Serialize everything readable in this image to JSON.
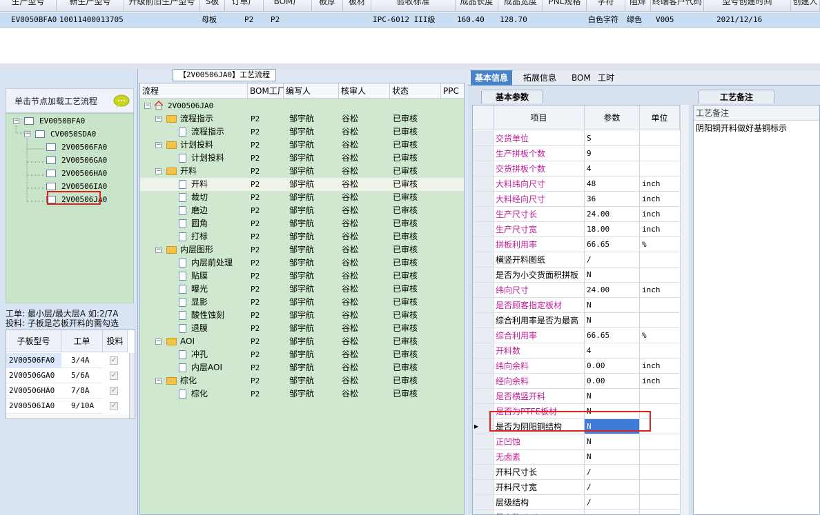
{
  "top_grid": {
    "headers": [
      "生产型号",
      "新生产型号",
      "升级前旧生产型号",
      "S板",
      "订单厂",
      "BOM厂",
      "板厚",
      "板材",
      "验收标准",
      "成品长度",
      "成品宽度",
      "PNL规格",
      "字符",
      "阻焊",
      "终端客户代码",
      "型号创建时间",
      "创建人"
    ],
    "row": [
      "EV0050BFA0",
      "10011400013705",
      "",
      "母板",
      "P2",
      "P2",
      "",
      "",
      "IPC-6012 III级",
      "160.40",
      "128.70",
      "",
      "白色字符",
      "绿色",
      "V005",
      "2021/12/16",
      ""
    ]
  },
  "left": {
    "hint": "单击节点加载工艺流程",
    "tree": [
      {
        "label": "EV0050BFA0"
      },
      {
        "label": "CV0050SDA0"
      },
      {
        "label": "2V00506FA0"
      },
      {
        "label": "2V00506GA0"
      },
      {
        "label": "2V00506HA0"
      },
      {
        "label": "2V00506IA0"
      },
      {
        "label": "2V00506JA0"
      }
    ],
    "info_line1": "工单: 最小层/最大层A 如:2/7A",
    "info_line2": "投料: 子板是芯板开料的需勾选",
    "sub_grid": {
      "headers": [
        "子板型号",
        "工单",
        "投料"
      ],
      "rows": [
        {
          "model": "2V00506FA0",
          "order": "3/4A"
        },
        {
          "model": "2V00506GA0",
          "order": "5/6A"
        },
        {
          "model": "2V00506HA0",
          "order": "7/8A"
        },
        {
          "model": "2V00506IA0",
          "order": "9/10A"
        }
      ]
    }
  },
  "middle": {
    "title": "【2V00506JA0】工艺流程",
    "headers": [
      "流程",
      "BOM工厂",
      "编写人",
      "核审人",
      "状态",
      "PPC"
    ],
    "root": "2V00506JA0",
    "rows": [
      {
        "name": "流程指示",
        "bom": "P2",
        "writer": "邹宇航",
        "reviewer": "谷松",
        "status": "已审核"
      },
      {
        "name": "流程指示",
        "bom": "P2",
        "writer": "邹宇航",
        "reviewer": "谷松",
        "status": "已审核"
      },
      {
        "name": "计划投料",
        "bom": "P2",
        "writer": "邹宇航",
        "reviewer": "谷松",
        "status": "已审核"
      },
      {
        "name": "计划投料",
        "bom": "P2",
        "writer": "邹宇航",
        "reviewer": "谷松",
        "status": "已审核"
      },
      {
        "name": "开料",
        "bom": "P2",
        "writer": "邹宇航",
        "reviewer": "谷松",
        "status": "已审核"
      },
      {
        "name": "开料",
        "bom": "P2",
        "writer": "邹宇航",
        "reviewer": "谷松",
        "status": "已审核"
      },
      {
        "name": "裁切",
        "bom": "P2",
        "writer": "邹宇航",
        "reviewer": "谷松",
        "status": "已审核"
      },
      {
        "name": "磨边",
        "bom": "P2",
        "writer": "邹宇航",
        "reviewer": "谷松",
        "status": "已审核"
      },
      {
        "name": "圆角",
        "bom": "P2",
        "writer": "邹宇航",
        "reviewer": "谷松",
        "status": "已审核"
      },
      {
        "name": "打标",
        "bom": "P2",
        "writer": "邹宇航",
        "reviewer": "谷松",
        "status": "已审核"
      },
      {
        "name": "内层图形",
        "bom": "P2",
        "writer": "邹宇航",
        "reviewer": "谷松",
        "status": "已审核"
      },
      {
        "name": "内层前处理",
        "bom": "P2",
        "writer": "邹宇航",
        "reviewer": "谷松",
        "status": "已审核"
      },
      {
        "name": "贴膜",
        "bom": "P2",
        "writer": "邹宇航",
        "reviewer": "谷松",
        "status": "已审核"
      },
      {
        "name": "曝光",
        "bom": "P2",
        "writer": "邹宇航",
        "reviewer": "谷松",
        "status": "已审核"
      },
      {
        "name": "显影",
        "bom": "P2",
        "writer": "邹宇航",
        "reviewer": "谷松",
        "status": "已审核"
      },
      {
        "name": "酸性蚀刻",
        "bom": "P2",
        "writer": "邹宇航",
        "reviewer": "谷松",
        "status": "已审核"
      },
      {
        "name": "退膜",
        "bom": "P2",
        "writer": "邹宇航",
        "reviewer": "谷松",
        "status": "已审核"
      },
      {
        "name": "AOI",
        "bom": "P2",
        "writer": "邹宇航",
        "reviewer": "谷松",
        "status": "已审核"
      },
      {
        "name": "冲孔",
        "bom": "P2",
        "writer": "邹宇航",
        "reviewer": "谷松",
        "status": "已审核"
      },
      {
        "name": "内层AOI",
        "bom": "P2",
        "writer": "邹宇航",
        "reviewer": "谷松",
        "status": "已审核"
      },
      {
        "name": "棕化",
        "bom": "P2",
        "writer": "邹宇航",
        "reviewer": "谷松",
        "status": "已审核"
      },
      {
        "name": "棕化",
        "bom": "P2",
        "writer": "邹宇航",
        "reviewer": "谷松",
        "status": "已审核"
      }
    ]
  },
  "right": {
    "tabs": [
      "基本信息",
      "拓展信息",
      "BOM",
      "工时"
    ],
    "section_label": "基本参数",
    "notes_tab": "工艺备注",
    "notes_header": "工艺备注",
    "notes_text": "阴阳铜开料做好基铜标示",
    "param_headers": [
      "项目",
      "参数",
      "单位"
    ],
    "params": [
      {
        "item": "交货单位",
        "value": "S",
        "unit": ""
      },
      {
        "item": "生产拼板个数",
        "value": "9",
        "unit": ""
      },
      {
        "item": "交货拼板个数",
        "value": "4",
        "unit": ""
      },
      {
        "item": "大料纬向尺寸",
        "value": "48",
        "unit": "inch"
      },
      {
        "item": "大料经向尺寸",
        "value": "36",
        "unit": "inch"
      },
      {
        "item": "生产尺寸长",
        "value": "24.00",
        "unit": "inch"
      },
      {
        "item": "生产尺寸宽",
        "value": "18.00",
        "unit": "inch"
      },
      {
        "item": "拼板利用率",
        "value": "66.65",
        "unit": "%"
      },
      {
        "item": "横竖开料图纸",
        "value": "/",
        "unit": ""
      },
      {
        "item": "是否为小交货面积拼板",
        "value": "N",
        "unit": ""
      },
      {
        "item": "纬向尺寸",
        "value": "24.00",
        "unit": "inch"
      },
      {
        "item": "是否顾客指定板材",
        "value": "N",
        "unit": ""
      },
      {
        "item": "综合利用率是否为最高",
        "value": "N",
        "unit": ""
      },
      {
        "item": "综合利用率",
        "value": "66.65",
        "unit": "%"
      },
      {
        "item": "开料数",
        "value": "4",
        "unit": ""
      },
      {
        "item": "纬向余料",
        "value": "0.00",
        "unit": "inch"
      },
      {
        "item": "经向余料",
        "value": "0.00",
        "unit": "inch"
      },
      {
        "item": "是否横竖开料",
        "value": "N",
        "unit": ""
      },
      {
        "item": "是否为PTFE板材",
        "value": "N",
        "unit": ""
      },
      {
        "item": "是否为阴阳铜结构",
        "value": "N",
        "unit": ""
      },
      {
        "item": "正凹蚀",
        "value": "N",
        "unit": ""
      },
      {
        "item": "无卤素",
        "value": "N",
        "unit": ""
      },
      {
        "item": "开料尺寸长",
        "value": "/",
        "unit": ""
      },
      {
        "item": "开料尺寸宽",
        "value": "/",
        "unit": ""
      },
      {
        "item": "层级结构",
        "value": "/",
        "unit": ""
      },
      {
        "item": "最小孔Pitch",
        "value": "/",
        "unit": ""
      }
    ]
  },
  "colors": {
    "accent": "#4a82c8",
    "tree_bg": "#cfe8cf",
    "highlight": "#e02020",
    "pink_label": "#c0209a"
  }
}
